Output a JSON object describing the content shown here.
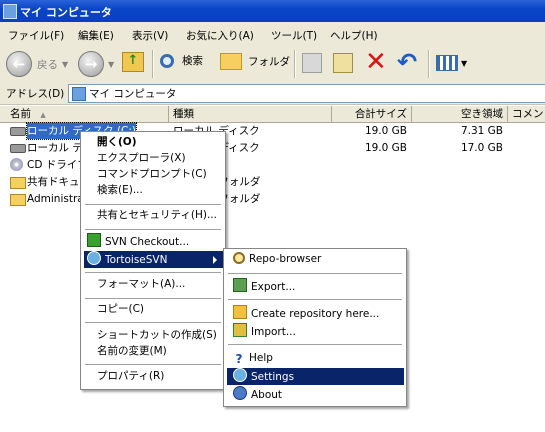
{
  "window": {
    "title": "マイ コンピュータ"
  },
  "menubar": {
    "items": [
      "ファイル(F)",
      "編集(E)",
      "表示(V)",
      "お気に入り(A)",
      "ツール(T)",
      "ヘルプ(H)"
    ]
  },
  "toolbar": {
    "back_label": "戻る",
    "search_label": "検索",
    "folders_label": "フォルダ"
  },
  "address": {
    "label": "アドレス(D)",
    "value": "マイ コンピュータ"
  },
  "columns": {
    "name": "名前",
    "type": "種類",
    "total": "合計サイズ",
    "free": "空き領域",
    "comment": "コメント"
  },
  "rows": [
    {
      "name": "ローカル ディスク (C:)",
      "type": "ローカル ディスク",
      "total": "19.0 GB",
      "free": "7.31 GB"
    },
    {
      "name": "ローカル ディスク (D:)",
      "type": "ローカル ディスク",
      "total": "19.0 GB",
      "free": "17.0 GB"
    },
    {
      "name": "CD ドライブ",
      "type": "",
      "total": "",
      "free": ""
    },
    {
      "name": "共有ドキュメント",
      "type": "ファイル フォルダ",
      "total": "",
      "free": ""
    },
    {
      "name": "Administrator",
      "type": "ファイル フォルダ",
      "total": "",
      "free": ""
    }
  ],
  "context_menu": {
    "open": "開く(O)",
    "explorer": "エクスプローラ(X)",
    "cmd": "コマンドプロンプト(C)",
    "search": "検索(E)...",
    "sharing": "共有とセキュリティ(H)...",
    "svn_checkout": "SVN Checkout...",
    "tortoise": "TortoiseSVN",
    "format": "フォーマット(A)...",
    "copy": "コピー(C)",
    "shortcut": "ショートカットの作成(S)",
    "rename": "名前の変更(M)",
    "properties": "プロパティ(R)"
  },
  "submenu": {
    "repo_browser": "Repo-browser",
    "export": "Export...",
    "create_repo": "Create repository here...",
    "import": "Import...",
    "help": "Help",
    "settings": "Settings",
    "about": "About"
  },
  "colors": {
    "titlebar": "#0a45c8",
    "highlight": "#0a246a",
    "selection": "#316ac5"
  }
}
